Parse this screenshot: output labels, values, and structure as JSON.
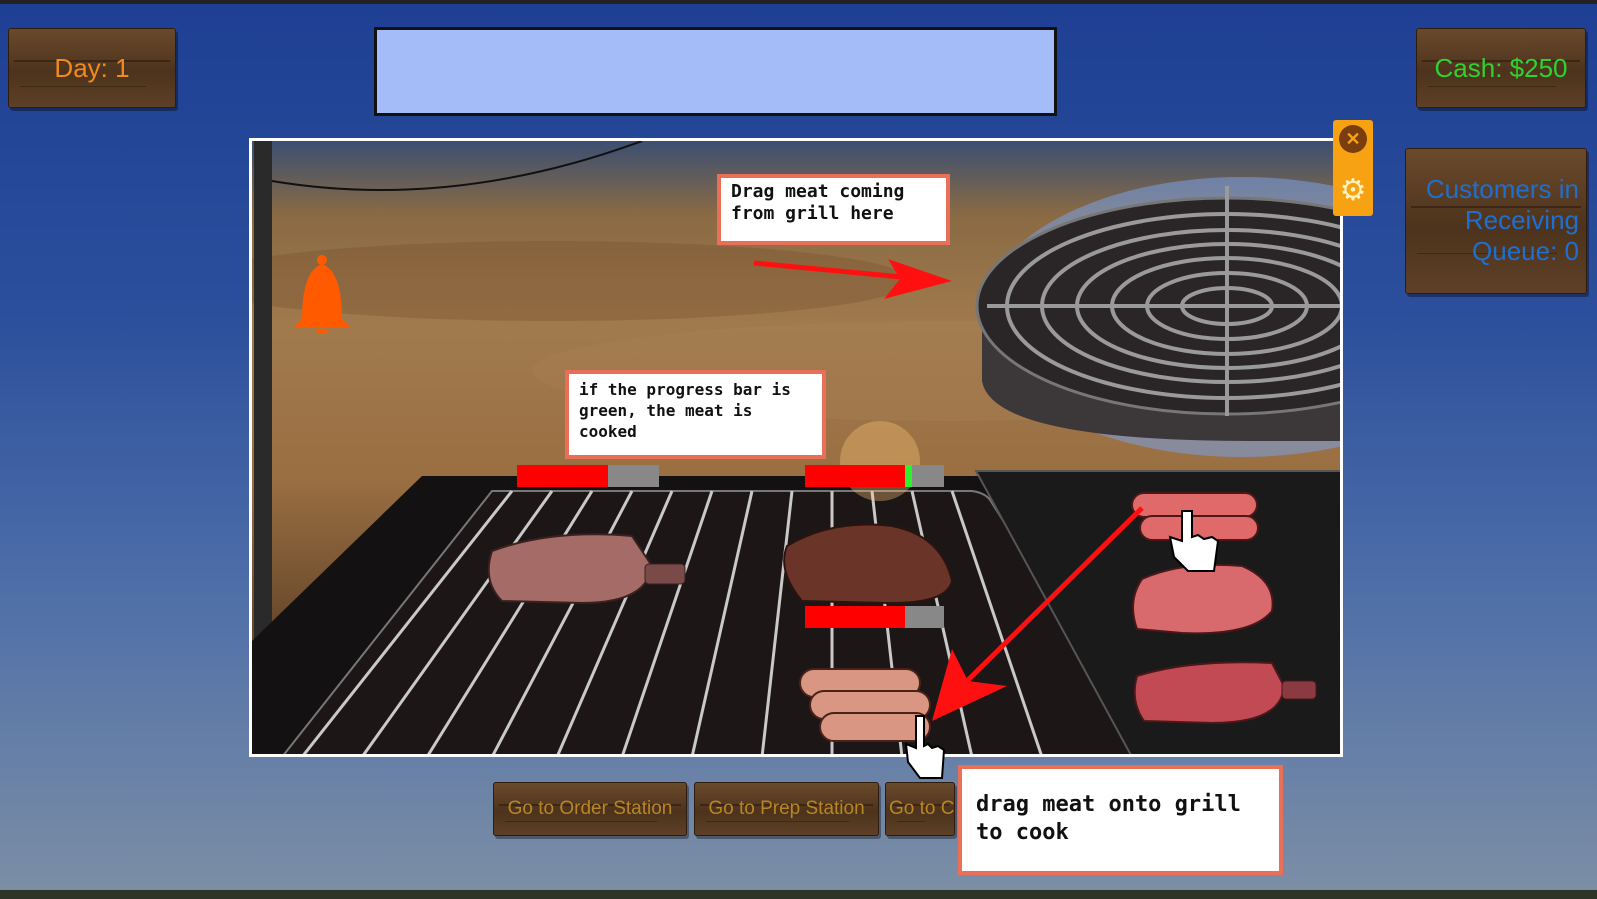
{
  "hud": {
    "day_label": "Day: 1",
    "cash_label": "Cash: $250",
    "queue_label_line1": "Customers in",
    "queue_label_line2": "Receiving",
    "queue_label_line3": "Queue: 0"
  },
  "message_bar": {
    "text": ""
  },
  "tutorial": {
    "tip_grill_pickup": "Drag meat coming from grill here",
    "tip_progress": "if the progress bar is green, the meat is cooked",
    "tip_drag_onto_grill": "drag meat onto grill to cook"
  },
  "controls": {
    "close_icon": "close-icon",
    "settings_icon": "gear-icon",
    "close_glyph": "✕",
    "gear_glyph": "⚙"
  },
  "nav": {
    "order_station": "Go to Order Station",
    "prep_station": "Go to Prep Station",
    "third_station": "Go to C"
  },
  "cooking": {
    "ribs_progress": 0.64,
    "steak_progress": 0.72,
    "steak_green_zone": true,
    "sausage_progress": 0.72
  },
  "colors": {
    "day_text": "#f28a1d",
    "cash_text": "#2fd22f",
    "queue_text": "#1f6fd1",
    "tip_border": "#ea6f58",
    "progress_fill": "#ff0000",
    "progress_ok": "#2cf12c",
    "bell": "#ff5a00"
  }
}
